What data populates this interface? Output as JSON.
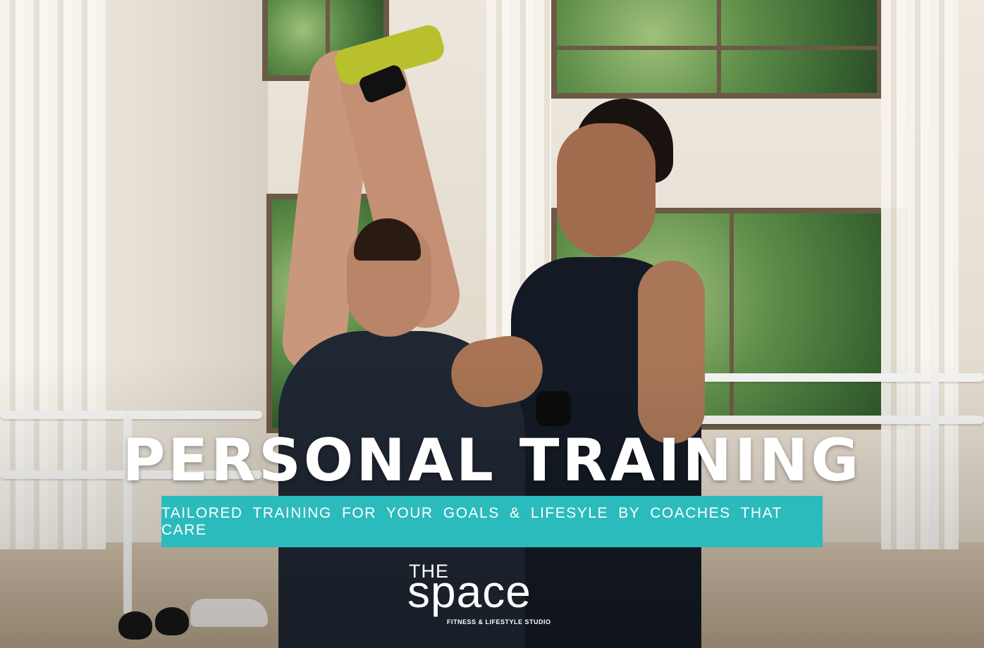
{
  "headline": "PERSONAL TRAINING",
  "tagline": "TAILORED TRAINING FOR YOUR GOALS & LIFESYLE BY COACHES THAT CARE",
  "logo": {
    "the": "THE",
    "space": "space",
    "subtitle": "FITNESS & LIFESTYLE STUDIO"
  },
  "colors": {
    "accent": "#2bbbbd",
    "text": "#ffffff"
  }
}
